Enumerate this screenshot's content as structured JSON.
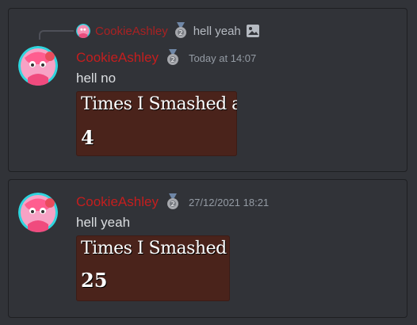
{
  "messages": [
    {
      "reply": {
        "username": "CookieAshley",
        "text": "hell yeah"
      },
      "username": "CookieAshley",
      "timestamp": "Today at 14:07",
      "text": "hell no",
      "embed": {
        "title": "Times I Smashed a",
        "count": "4"
      }
    },
    {
      "username": "CookieAshley",
      "timestamp": "27/12/2021 18:21",
      "text": "hell yeah",
      "embed": {
        "title": "Times I Smashed",
        "count": "25"
      }
    }
  ],
  "colors": {
    "background": "#313338",
    "username": "#c41e1e",
    "text": "#dbdee1",
    "timestamp": "#949ba4",
    "embed_background": "#4a231b"
  },
  "icons": [
    "image-icon",
    "medal-badge-icon"
  ]
}
